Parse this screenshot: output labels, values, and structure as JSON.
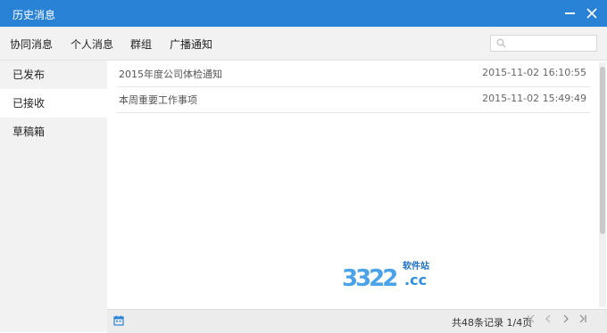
{
  "window": {
    "title": "历史消息"
  },
  "tabs": [
    {
      "label": "协同消息"
    },
    {
      "label": "个人消息"
    },
    {
      "label": "群组"
    },
    {
      "label": "广播通知"
    }
  ],
  "search": {
    "placeholder": "",
    "value": ""
  },
  "sidebar": {
    "items": [
      {
        "label": "已发布",
        "active": false
      },
      {
        "label": "已接收",
        "active": true
      },
      {
        "label": "草稿箱",
        "active": false
      }
    ]
  },
  "messages": [
    {
      "subject": "2015年度公司体检通知",
      "time": "2015-11-02 16:10:55"
    },
    {
      "subject": "本周重要工作事项",
      "time": "2015-11-02 15:49:49"
    }
  ],
  "watermark": {
    "number": "3322",
    "tagline": "软件站",
    "domain": ".cc"
  },
  "footer": {
    "record_info": "共48条记录 1/4页"
  },
  "pager_icons": [
    "first-page-icon",
    "prev-page-icon",
    "next-page-icon",
    "last-page-icon"
  ],
  "colors": {
    "titlebar": "#2a82d6",
    "sidebar_bg": "#f2f2f2",
    "footer_bg": "#ececec"
  }
}
